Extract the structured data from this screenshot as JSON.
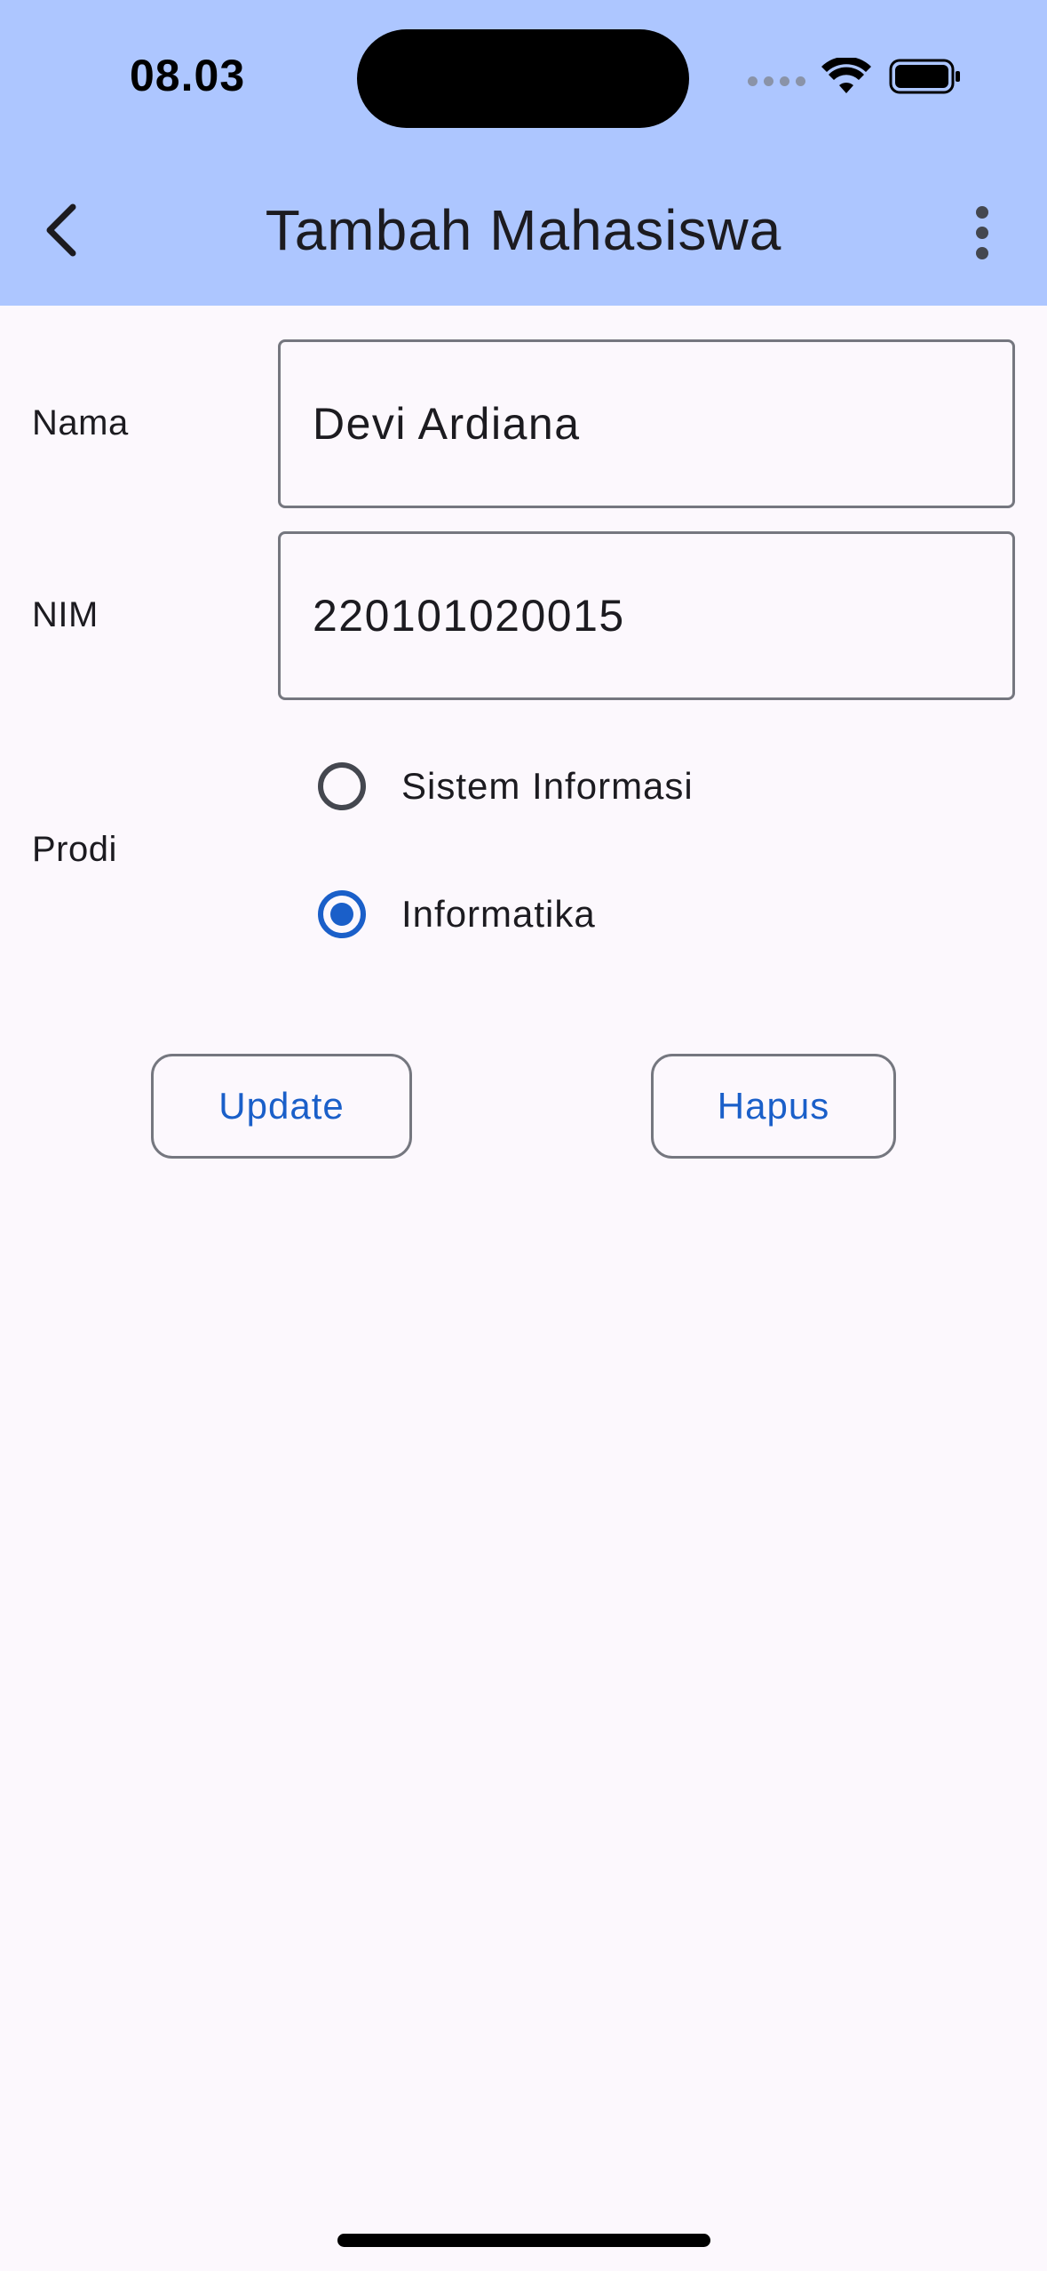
{
  "status_bar": {
    "time": "08.03"
  },
  "app_bar": {
    "title": "Tambah Mahasiswa",
    "back_icon": "chevron-left-icon",
    "menu_icon": "more-vert-icon",
    "background_color": "#adc6ff"
  },
  "form": {
    "nama": {
      "label": "Nama",
      "value": "Devi Ardiana"
    },
    "nim": {
      "label": "NIM",
      "value": "220101020015"
    },
    "prodi": {
      "label": "Prodi",
      "options": [
        {
          "label": "Sistem Informasi",
          "selected": false
        },
        {
          "label": "Informatika",
          "selected": true
        }
      ]
    }
  },
  "actions": {
    "update_label": "Update",
    "hapus_label": "Hapus",
    "accent_color": "#1a5fc9"
  }
}
